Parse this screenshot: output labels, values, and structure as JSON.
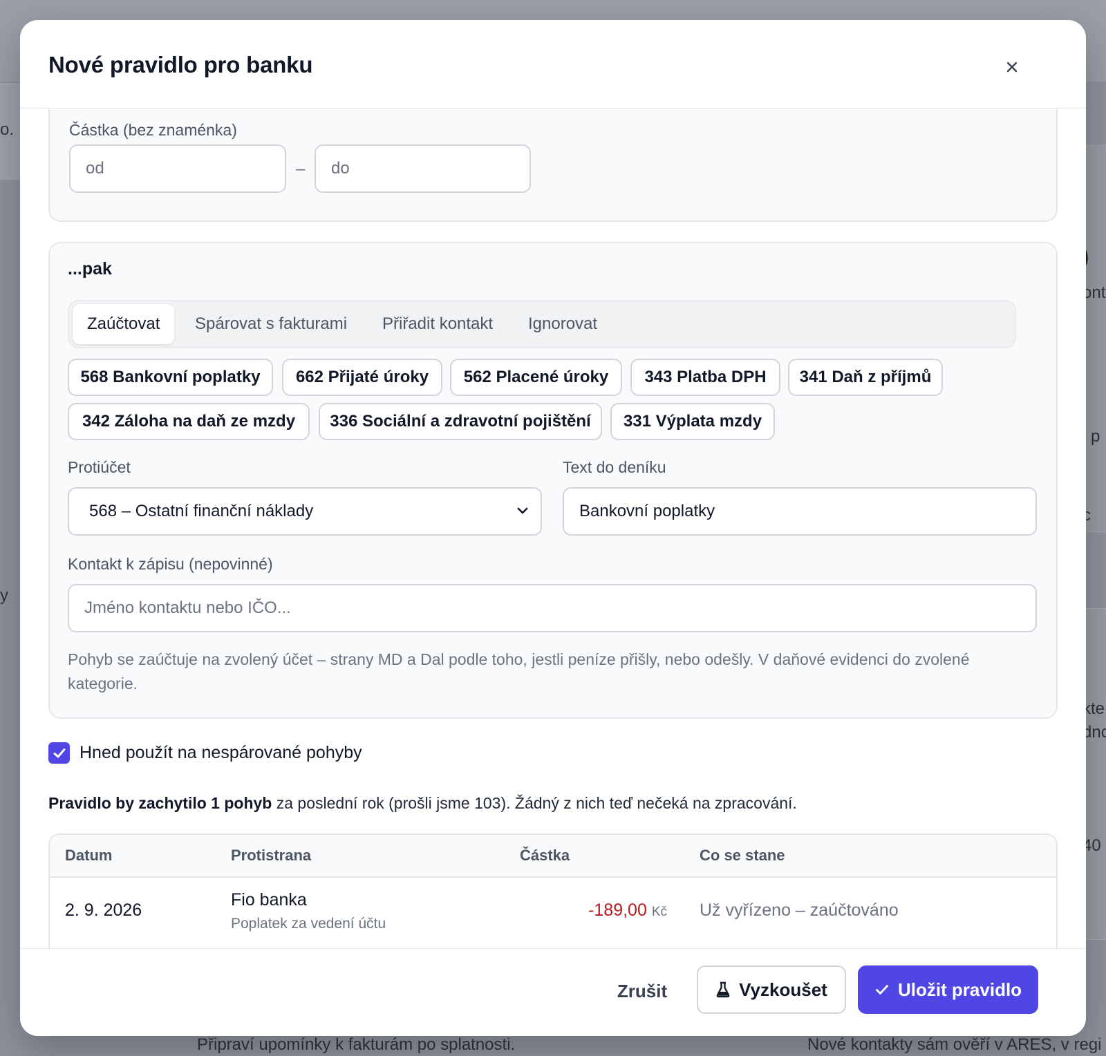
{
  "modal": {
    "title": "Nové pravidlo pro banku",
    "close_icon": "close-icon"
  },
  "amount_filter": {
    "label": "Částka (bez znaménka)",
    "from_placeholder": "od",
    "separator": "–",
    "to_placeholder": "do"
  },
  "action": {
    "heading": "...pak",
    "tabs": [
      {
        "label": "Zaúčtovat",
        "active": true
      },
      {
        "label": "Spárovat s fakturami",
        "active": false
      },
      {
        "label": "Přiřadit kontakt",
        "active": false
      },
      {
        "label": "Ignorovat",
        "active": false
      }
    ],
    "quick_accounts": [
      "568 Bankovní poplatky",
      "662 Přijaté úroky",
      "562 Placené úroky",
      "343 Platba DPH",
      "341 Daň z příjmů",
      "342 Záloha na daň ze mzdy",
      "336 Sociální a zdravotní pojištění",
      "331 Výplata mzdy"
    ],
    "counter_account": {
      "label": "Protiúčet",
      "value": "568 – Ostatní finanční náklady"
    },
    "journal_text": {
      "label": "Text do deníku",
      "value": "Bankovní poplatky"
    },
    "contact": {
      "label": "Kontakt k zápisu (nepovinné)",
      "placeholder": "Jméno kontaktu nebo IČO..."
    },
    "hint": "Pohyb se zaúčtuje na zvolený účet – strany MD a Dal podle toho, jestli peníze přišly, nebo odešly. V daňové evidenci do zvolené kategorie."
  },
  "apply_now": {
    "label": "Hned použít na nespárované pohyby",
    "checked": true
  },
  "summary": {
    "bold": "Pravidlo by zachytilo 1 pohyb",
    "rest": " za poslední rok (prošli jsme 103). Žádný z nich teď nečeká na zpracování."
  },
  "preview_table": {
    "columns": [
      "Datum",
      "Protistrana",
      "Částka",
      "Co se stane"
    ],
    "rows": [
      {
        "date": "2. 9. 2026",
        "counterparty": "Fio banka",
        "note": "Poplatek za vedení účtu",
        "amount": "-189,00",
        "currency": "Kč",
        "outcome": "Už vyřízeno – zaúčtováno"
      }
    ]
  },
  "footer": {
    "cancel": "Zrušit",
    "try": "Vyzkoušet",
    "try_icon": "flask-icon",
    "save": "Uložit pravidlo",
    "save_icon": "check-icon"
  },
  "background": {
    "left_fragment_1": "o.",
    "left_fragment_2": "y",
    "right_fragment_big": "0",
    "right_fragment_1": "ont",
    "right_fragment_2": "i p",
    "right_fragment_3": "c",
    "right_fragment_4": "kte",
    "right_fragment_5": "dnc",
    "right_fragment_6": "40",
    "bottom_text_left": "Připraví upomínky k fakturám po splatnosti.",
    "bottom_text_right": "Nové kontakty sám ověří v ARES, v regi"
  },
  "colors": {
    "accent": "#4f46e5",
    "negative_amount": "#b91c1c",
    "overlay": "#8e929b"
  }
}
